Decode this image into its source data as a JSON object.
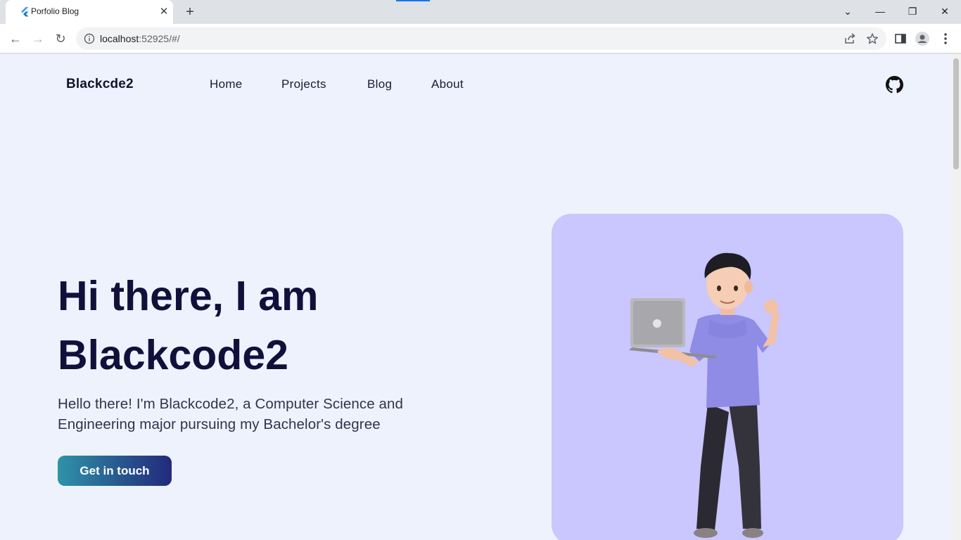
{
  "browser": {
    "tab_title": "Porfolio Blog",
    "tab_close": "✕",
    "new_tab": "+",
    "url_host": "localhost",
    "url_rest": ":52925/#/",
    "window_controls": {
      "dropdown": "⌄",
      "minimize": "—",
      "restore": "❐",
      "close": "✕"
    },
    "nav": {
      "back": "←",
      "forward": "→",
      "reload": "↻"
    }
  },
  "site": {
    "brand": "Blackcde2",
    "nav": [
      {
        "label": "Home"
      },
      {
        "label": "Projects"
      },
      {
        "label": "Blog"
      },
      {
        "label": "About"
      }
    ],
    "hero": {
      "title_line1": "Hi there, I am",
      "title_line2": "Blackcode2",
      "description": "Hello there! I'm Blackcode2, a Computer Science and Engineering major pursuing my Bachelor's degree",
      "cta_label": "Get in touch"
    }
  },
  "colors": {
    "page_bg": "#eef2fd",
    "card_bg": "#cac6fe",
    "title": "#12103a",
    "cta_start": "#2f93a8",
    "cta_end": "#222a7a"
  }
}
